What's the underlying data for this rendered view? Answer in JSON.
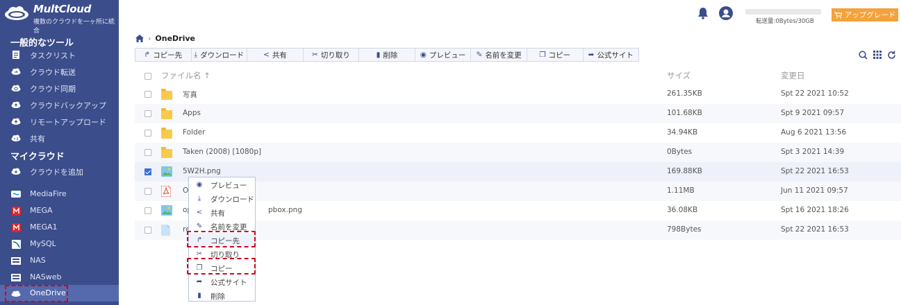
{
  "brand": {
    "name": "MultCloud",
    "tagline": "複数のクラウドを一ヶ所に統合"
  },
  "sidebar": {
    "section_tools": "一般的なツール",
    "tools": [
      {
        "label": "タスクリスト",
        "icon": "task-list-icon"
      },
      {
        "label": "クラウド転送",
        "icon": "cloud-transfer-icon"
      },
      {
        "label": "クラウド同期",
        "icon": "cloud-sync-icon"
      },
      {
        "label": "クラウドバックアップ",
        "icon": "cloud-backup-icon"
      },
      {
        "label": "リモートアップロード",
        "icon": "remote-upload-icon"
      },
      {
        "label": "共有",
        "icon": "share-icon"
      }
    ],
    "section_clouds": "マイクラウド",
    "add_cloud": "クラウドを追加",
    "clouds": [
      {
        "label": "MediaFire",
        "icon": "mediafire-icon"
      },
      {
        "label": "MEGA",
        "icon": "mega-icon"
      },
      {
        "label": "MEGA1",
        "icon": "mega-icon"
      },
      {
        "label": "MySQL",
        "icon": "mysql-icon"
      },
      {
        "label": "NAS",
        "icon": "nas-icon"
      },
      {
        "label": "NASweb",
        "icon": "nas-icon"
      },
      {
        "label": "OneDrive",
        "icon": "onedrive-icon"
      }
    ],
    "active": "OneDrive"
  },
  "topbar": {
    "quota": "転送量:0Bytes/30GB",
    "quota_used": 0,
    "upgrade": "アップグレード"
  },
  "breadcrumb": {
    "current": "OneDrive"
  },
  "toolbar": [
    {
      "label": "コピー先",
      "icon": "copy-to-icon"
    },
    {
      "label": "ダウンロード",
      "icon": "download-icon"
    },
    {
      "label": "共有",
      "icon": "share-icon"
    },
    {
      "label": "切り取り",
      "icon": "cut-icon"
    },
    {
      "label": "削除",
      "icon": "delete-icon"
    },
    {
      "label": "プレビュー",
      "icon": "preview-icon"
    },
    {
      "label": "名前を変更",
      "icon": "rename-icon"
    },
    {
      "label": "コピー",
      "icon": "copy-icon"
    },
    {
      "label": "公式サイト",
      "icon": "official-site-icon"
    }
  ],
  "table": {
    "headers": {
      "name": "ファイル名",
      "size": "サイズ",
      "date": "変更日"
    },
    "rows": [
      {
        "name": "写真",
        "type": "folder",
        "size": "261.35KB",
        "date": "Spt 22 2021 10:52",
        "checked": false
      },
      {
        "name": "Apps",
        "type": "folder",
        "size": "101.68KB",
        "date": "Spt 9 2021 09:57",
        "checked": false
      },
      {
        "name": "Folder",
        "type": "folder",
        "size": "34.94KB",
        "date": "Aug 6 2021 13:56",
        "checked": false
      },
      {
        "name": "Taken (2008) [1080p]",
        "type": "folder",
        "size": "0Bytes",
        "date": "Spt 3 2021 14:39",
        "checked": false
      },
      {
        "name": "5W2H.png",
        "type": "image",
        "size": "169.88KB",
        "date": "Spt 22 2021 16:53",
        "checked": true
      },
      {
        "name": "O",
        "type": "pdf",
        "size": "1.11MB",
        "date": "Jun 11 2021 09:57",
        "checked": false
      },
      {
        "name": "op",
        "name_tail": "pbox.png",
        "type": "image",
        "size": "36.08KB",
        "date": "Spt 16 2021 18:26",
        "checked": false
      },
      {
        "name": "re",
        "type": "file",
        "size": "798Bytes",
        "date": "Spt 22 2021 16:53",
        "checked": false
      }
    ]
  },
  "context_menu": [
    {
      "label": "プレビュー",
      "icon": "preview-icon"
    },
    {
      "label": "ダウンロード",
      "icon": "download-icon"
    },
    {
      "label": "共有",
      "icon": "share-icon"
    },
    {
      "label": "名前を変更",
      "icon": "rename-icon"
    },
    {
      "label": "コピー先",
      "icon": "copy-to-icon",
      "highlighted": true
    },
    {
      "label": "切り取り",
      "icon": "cut-icon"
    },
    {
      "label": "コピー",
      "icon": "copy-icon",
      "highlighted": true
    },
    {
      "label": "公式サイト",
      "icon": "official-site-icon"
    },
    {
      "label": "削除",
      "icon": "delete-icon"
    }
  ],
  "colors": {
    "sidebar": "#3b4d8b",
    "accent": "#3b6fd8",
    "upgrade": "#f4a23a",
    "highlight": "#d0021b"
  }
}
